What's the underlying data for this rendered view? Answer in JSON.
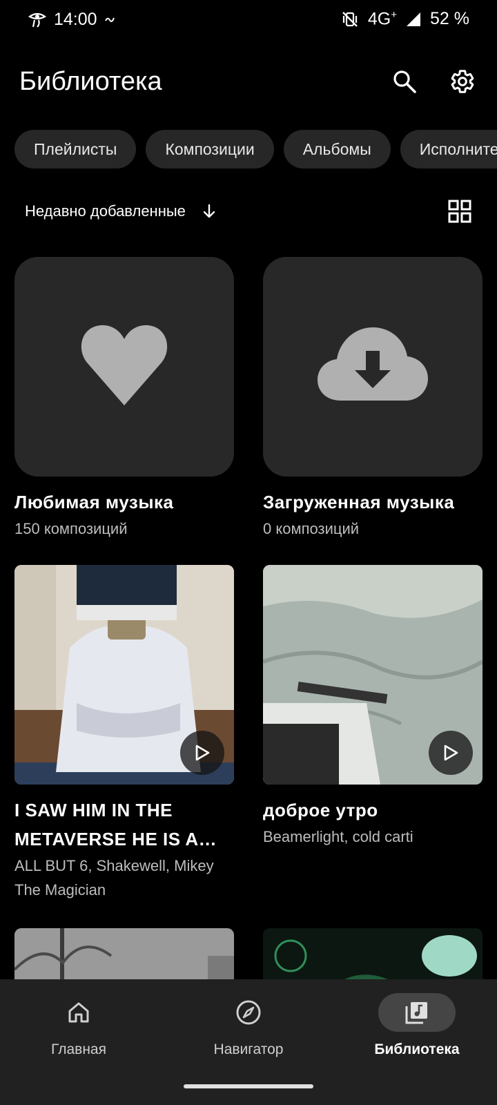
{
  "status_bar": {
    "time": "14:00",
    "network": "4G",
    "network_sup": "+",
    "battery": "52 %",
    "icons": [
      "hieroglyph-eye-icon",
      "small-glyph-icon",
      "mute-vibrate-icon",
      "signal-icon"
    ]
  },
  "header": {
    "title": "Библиотека",
    "actions": [
      "search-icon",
      "gear-icon"
    ]
  },
  "chips": [
    {
      "label": "Плейлисты"
    },
    {
      "label": "Композиции"
    },
    {
      "label": "Альбомы"
    },
    {
      "label": "Исполнители"
    }
  ],
  "sort": {
    "label": "Недавно добавленные",
    "direction_icon": "arrow-down-icon",
    "view_icon": "grid-view-icon"
  },
  "cards": [
    {
      "title": "Любимая музыка",
      "subtitle": "150 композиций",
      "icon": "heart-icon"
    },
    {
      "title": "Загруженная музыка",
      "subtitle": "0 композиций",
      "icon": "cloud-download-icon"
    },
    {
      "title": "I SAW HIM IN THE METAVERSE HE IS A…",
      "subtitle": "ALL BUT 6, Shakewell, Mikey The Magician",
      "icon": "play-icon"
    },
    {
      "title": "доброе утро",
      "subtitle": "Beamerlight, cold carti",
      "icon": "play-icon"
    }
  ],
  "bottom_nav": {
    "items": [
      {
        "label": "Главная",
        "icon": "home-icon",
        "active": false
      },
      {
        "label": "Навигатор",
        "icon": "compass-icon",
        "active": false
      },
      {
        "label": "Библиотека",
        "icon": "library-music-icon",
        "active": true
      }
    ]
  },
  "colors": {
    "background": "#000000",
    "surface": "#282828",
    "chip": "#272727",
    "nav_background": "#212121",
    "active_pill": "#454545",
    "icon_gray": "#b0b0b0"
  }
}
